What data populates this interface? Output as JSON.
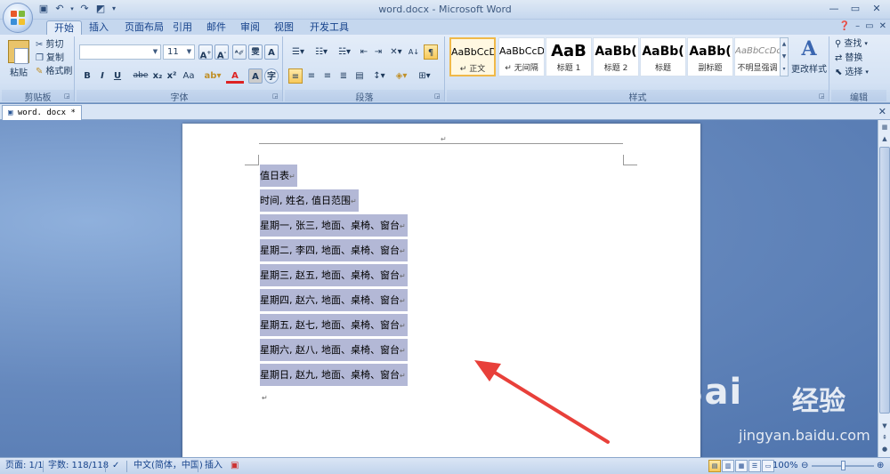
{
  "window": {
    "title": "word.docx - Microsoft Word",
    "qat": [
      "save-icon",
      "undo-icon",
      "redo-icon",
      "print-preview-icon",
      "customize-icon"
    ]
  },
  "tabs": [
    {
      "label": "开始",
      "active": true
    },
    {
      "label": "插入"
    },
    {
      "label": "页面布局"
    },
    {
      "label": "引用"
    },
    {
      "label": "邮件"
    },
    {
      "label": "审阅"
    },
    {
      "label": "视图"
    },
    {
      "label": "开发工具"
    }
  ],
  "ribbon": {
    "clipboard": {
      "label": "剪贴板",
      "paste": "粘贴",
      "cut": "剪切",
      "copy": "复制",
      "format_painter": "格式刷"
    },
    "font": {
      "label": "字体",
      "font_name": "",
      "font_size": "11",
      "buttons": [
        "B",
        "I",
        "U",
        "abe",
        "x₂",
        "x²",
        "Aa"
      ]
    },
    "paragraph": {
      "label": "段落"
    },
    "styles": {
      "label": "样式",
      "items": [
        {
          "sample": "AaBbCcD",
          "name": "↵ 正文",
          "selected": true
        },
        {
          "sample": "AaBbCcD",
          "name": "↵ 无间隔"
        },
        {
          "sample": "AaB",
          "name": "标题 1"
        },
        {
          "sample": "AaBb(",
          "name": "标题 2"
        },
        {
          "sample": "AaBb(",
          "name": "标题"
        },
        {
          "sample": "AaBb(",
          "name": "副标题"
        },
        {
          "sample": "AaBbCcDc",
          "name": "不明显强调"
        }
      ],
      "change_styles": "更改样式"
    },
    "editing": {
      "label": "编辑",
      "find": "查找",
      "replace": "替换",
      "select": "选择"
    }
  },
  "document_tab": "word. docx *",
  "document": {
    "header_mark": "↵",
    "paragraphs": [
      "值日表",
      "时间, 姓名, 值日范围",
      "星期一, 张三, 地面、桌椅、窗台",
      "星期二, 李四, 地面、桌椅、窗台",
      "星期三, 赵五, 地面、桌椅、窗台",
      "星期四, 赵六, 地面、桌椅、窗台",
      "星期五, 赵七, 地面、桌椅、窗台",
      "星期六, 赵八, 地面、桌椅、窗台",
      "星期日, 赵九, 地面、桌椅、窗台"
    ],
    "paragraph_mark": "↵",
    "selection_color": "#b3b8d6"
  },
  "watermark": {
    "brand": "Bai",
    "brand_cn": "经验",
    "url": "jingyan.baidu.com"
  },
  "statusbar": {
    "page": "页面: 1/1",
    "words": "字数: 118/118",
    "language": "中文(简体，中国)",
    "mode": "插入",
    "zoom": "100%"
  },
  "colors": {
    "annotation_arrow": "#e8403a",
    "ribbon_bg": "#d4e2f4",
    "workspace_bg": "#6588bd"
  }
}
